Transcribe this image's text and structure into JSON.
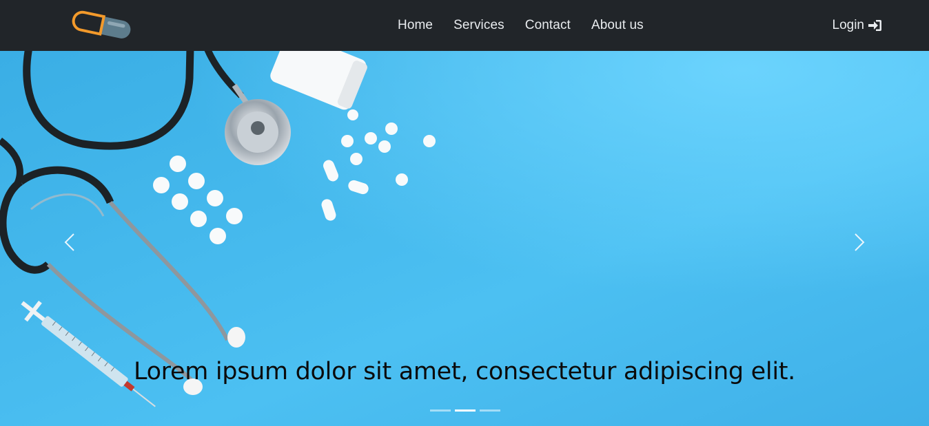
{
  "navbar": {
    "logo_icon": "pill-capsule-icon",
    "links": [
      {
        "label": "Home"
      },
      {
        "label": "Services"
      },
      {
        "label": "Contact"
      },
      {
        "label": "About us"
      }
    ],
    "login_label": "Login",
    "login_icon": "sign-in-icon"
  },
  "carousel": {
    "image": "medical-stethoscope-pills-image",
    "caption": "Lorem ipsum dolor sit amet, consectetur adipiscing elit.",
    "prev_icon": "chevron-left-icon",
    "next_icon": "chevron-right-icon",
    "slide_count": 3,
    "active_slide_index": 1
  },
  "colors": {
    "navbar_bg": "#212529",
    "nav_text": "#e9ecef",
    "hero_blue": "#41b3ea",
    "logo_orange": "#f39a2b",
    "logo_slate": "#5d7c8c"
  }
}
